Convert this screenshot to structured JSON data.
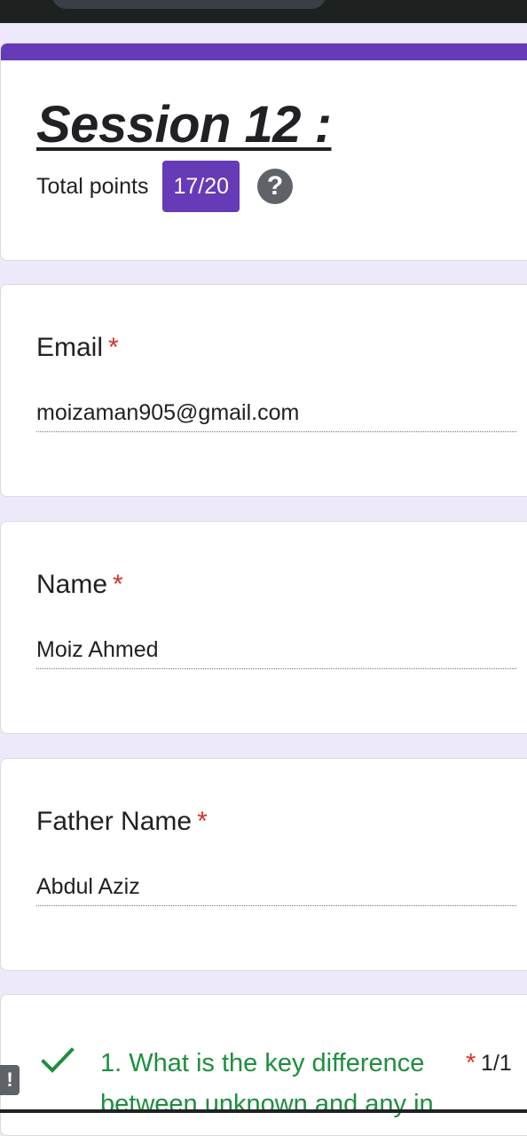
{
  "form": {
    "title": "Session 12 :",
    "total_points_label": "Total points",
    "score": "17/20",
    "help_glyph": "?",
    "accent_color": "#673ab7",
    "background_color": "#ede9fb"
  },
  "fields": [
    {
      "label": "Email",
      "required_mark": "*",
      "answer": "moizaman905@gmail.com"
    },
    {
      "label": "Name",
      "required_mark": "*",
      "answer": "Moiz Ahmed"
    },
    {
      "label": "Father Name",
      "required_mark": "*",
      "answer": "Abdul Aziz"
    }
  ],
  "question": {
    "text": "1.  What is the key difference between unknown and any in",
    "required_mark": "*",
    "score": "1/1",
    "status_icon": "check-icon",
    "correct_color": "#1e8e3e"
  },
  "feedback": {
    "glyph": "!"
  }
}
